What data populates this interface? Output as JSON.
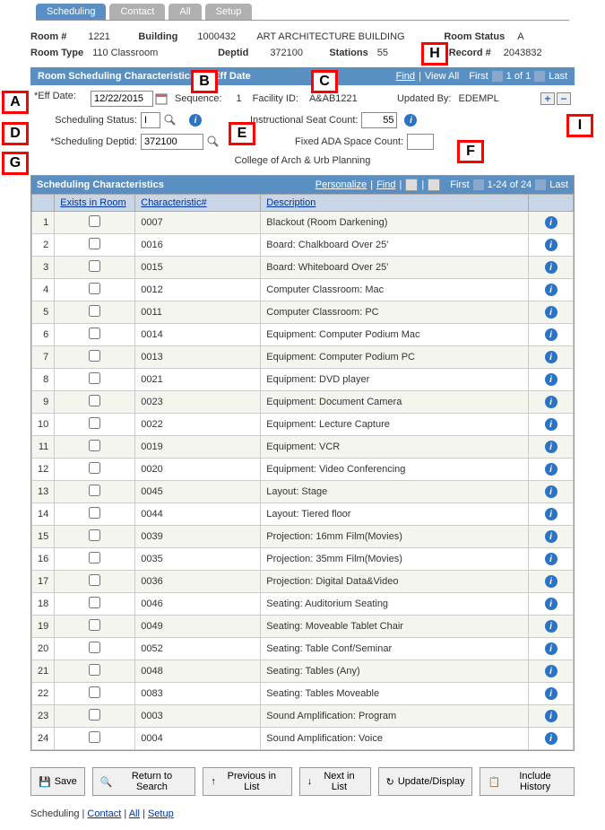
{
  "tabs": [
    "Scheduling",
    "Contact",
    "All",
    "Setup"
  ],
  "room_info": {
    "room_num_lbl": "Room #",
    "room_num": "1221",
    "building_lbl": "Building",
    "building": "1000432",
    "building_name": "ART ARCHITECTURE BUILDING",
    "room_status_lbl": "Room Status",
    "room_status": "A",
    "room_type_lbl": "Room Type",
    "room_type": "110 Classroom",
    "deptid_lbl": "Deptid",
    "deptid": "372100",
    "stations_lbl": "Stations",
    "stations": "55",
    "record_lbl": "Record #",
    "record": "2043832"
  },
  "section": {
    "title": "Room Scheduling Characteristics By Eff Date",
    "find": "Find",
    "view_all": "View All",
    "first": "First",
    "count": "1 of 1",
    "last": "Last"
  },
  "form": {
    "eff_date_lbl": "*Eff Date:",
    "eff_date": "12/22/2015",
    "sequence_lbl": "Sequence:",
    "sequence": "1",
    "facility_lbl": "Facility ID:",
    "facility": "A&AB1221",
    "updated_lbl": "Updated By:",
    "updated": "EDEMPL",
    "sched_status_lbl": "Scheduling Status:",
    "sched_status": "I",
    "seat_count_lbl": "Instructional Seat Count:",
    "seat_count": "55",
    "sched_deptid_lbl": "*Scheduling Deptid:",
    "sched_deptid": "372100",
    "ada_lbl": "Fixed ADA Space Count:",
    "ada": "",
    "dept_name": "College of Arch & Urb Planning"
  },
  "grid": {
    "title": "Scheduling Characteristics",
    "personalize": "Personalize",
    "find": "Find",
    "first": "First",
    "count": "1-24 of 24",
    "last": "Last",
    "cols": {
      "exists": "Exists in Room",
      "char": "Characteristic#",
      "desc": "Description"
    },
    "rows": [
      {
        "n": "1",
        "c": "0007",
        "d": "Blackout (Room Darkening)"
      },
      {
        "n": "2",
        "c": "0016",
        "d": "Board: Chalkboard Over 25'"
      },
      {
        "n": "3",
        "c": "0015",
        "d": "Board: Whiteboard Over 25'"
      },
      {
        "n": "4",
        "c": "0012",
        "d": "Computer Classroom: Mac"
      },
      {
        "n": "5",
        "c": "0011",
        "d": "Computer Classroom: PC"
      },
      {
        "n": "6",
        "c": "0014",
        "d": "Equipment: Computer Podium Mac"
      },
      {
        "n": "7",
        "c": "0013",
        "d": "Equipment: Computer Podium PC"
      },
      {
        "n": "8",
        "c": "0021",
        "d": "Equipment: DVD player"
      },
      {
        "n": "9",
        "c": "0023",
        "d": "Equipment: Document Camera"
      },
      {
        "n": "10",
        "c": "0022",
        "d": "Equipment: Lecture Capture"
      },
      {
        "n": "11",
        "c": "0019",
        "d": "Equipment: VCR"
      },
      {
        "n": "12",
        "c": "0020",
        "d": "Equipment: Video Conferencing"
      },
      {
        "n": "13",
        "c": "0045",
        "d": "Layout: Stage"
      },
      {
        "n": "14",
        "c": "0044",
        "d": "Layout: Tiered floor"
      },
      {
        "n": "15",
        "c": "0039",
        "d": "Projection: 16mm Film(Movies)"
      },
      {
        "n": "16",
        "c": "0035",
        "d": "Projection: 35mm Film(Movies)"
      },
      {
        "n": "17",
        "c": "0036",
        "d": "Projection: Digital Data&Video"
      },
      {
        "n": "18",
        "c": "0046",
        "d": "Seating: Auditorium Seating"
      },
      {
        "n": "19",
        "c": "0049",
        "d": "Seating: Moveable Tablet Chair"
      },
      {
        "n": "20",
        "c": "0052",
        "d": "Seating: Table Conf/Seminar"
      },
      {
        "n": "21",
        "c": "0048",
        "d": "Seating: Tables (Any)"
      },
      {
        "n": "22",
        "c": "0083",
        "d": "Seating: Tables Moveable"
      },
      {
        "n": "23",
        "c": "0003",
        "d": "Sound Amplification: Program"
      },
      {
        "n": "24",
        "c": "0004",
        "d": "Sound Amplification: Voice"
      }
    ]
  },
  "actions": {
    "save": "Save",
    "return": "Return to Search",
    "prev": "Previous in List",
    "next": "Next in List",
    "update": "Update/Display",
    "history": "Include History"
  },
  "bottom": {
    "scheduling": "Scheduling",
    "contact": "Contact",
    "all": "All",
    "setup": "Setup"
  },
  "annotations": {
    "A": "A",
    "B": "B",
    "C": "C",
    "D": "D",
    "E": "E",
    "F": "F",
    "G": "G",
    "H": "H",
    "I": "I"
  }
}
